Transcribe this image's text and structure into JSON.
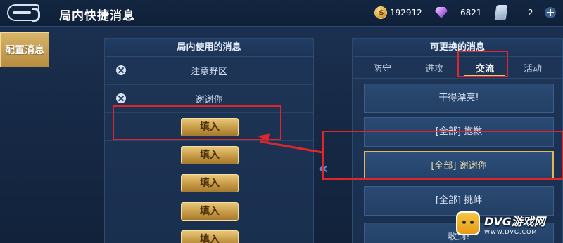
{
  "header": {
    "title": "局内快捷消息",
    "gold": "192912",
    "gems": "6821",
    "cards": "2"
  },
  "side_tab": {
    "label": "配置消息"
  },
  "left_panel": {
    "title": "局内使用的消息",
    "messages": [
      {
        "text": "注意野区"
      },
      {
        "text": "谢谢你"
      }
    ],
    "fill_buttons": [
      "填入",
      "填入",
      "填入",
      "填入",
      "填入"
    ]
  },
  "right_panel": {
    "title": "可更换的消息",
    "tabs": [
      {
        "label": "防守",
        "active": false
      },
      {
        "label": "进攻",
        "active": false
      },
      {
        "label": "交流",
        "active": true
      },
      {
        "label": "活动",
        "active": false
      }
    ],
    "options": [
      {
        "text": "干得漂亮!",
        "selected": false
      },
      {
        "text": "[全部] 抱歉",
        "selected": false
      },
      {
        "text": "[全部] 谢谢你",
        "selected": true
      },
      {
        "text": "[全部] 挑衅",
        "selected": false
      },
      {
        "text": "收到!",
        "selected": false
      }
    ]
  },
  "watermark": {
    "main": "DVG游戏网",
    "sub": "WWW.DVG.COM"
  },
  "colors": {
    "accent_gold": "#e2b555",
    "annotation_red": "#e0262a",
    "panel_bg": "#1e3557"
  }
}
